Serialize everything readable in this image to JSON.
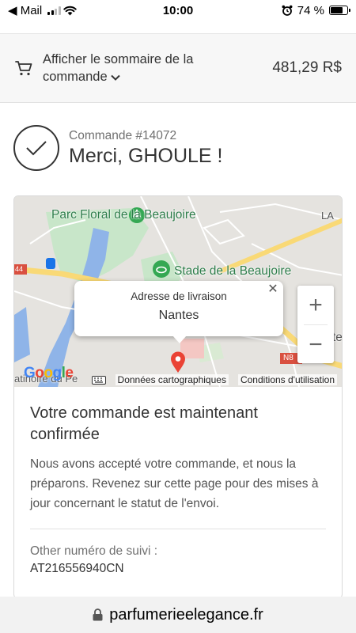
{
  "status_bar": {
    "back_app": "◀ Mail",
    "time": "10:00",
    "battery_percent": "74 %",
    "battery_level": 0.74
  },
  "summary": {
    "toggle_label": "Afficher le sommaire de la commande",
    "total": "481,29 R$"
  },
  "thanks": {
    "order_number": "Commande #14072",
    "title": "Merci, GHOULE !"
  },
  "map": {
    "labels": {
      "parc": "Parc Floral de la Beaujoire",
      "stade": "Stade de la Beaujoire",
      "la": "LA",
      "te": "te",
      "road_44": "44",
      "road_n8": "N8",
      "bottom_left": "atinoire du Pe"
    },
    "infowindow": {
      "heading": "Adresse de livraison",
      "city": "Nantes"
    },
    "footer": {
      "brand": "Google",
      "map_data": "Données cartographiques",
      "terms": "Conditions d'utilisation"
    },
    "colors": {
      "land": "#e5e3df",
      "water": "#8fb4e8",
      "park": "#c8e6c9",
      "highway": "#f9d976",
      "pin": "#ea4335"
    }
  },
  "confirmation": {
    "title": "Votre commande est maintenant confirmée",
    "text": "Nous avons accepté votre commande, et nous la préparons. Revenez sur cette page pour des mises à jour concernant le statut de l'envoi.",
    "tracking_label": "Other numéro de suivi :",
    "tracking_number": "AT216556940CN"
  },
  "url_bar": {
    "domain": "parfumerieelegance.fr"
  }
}
